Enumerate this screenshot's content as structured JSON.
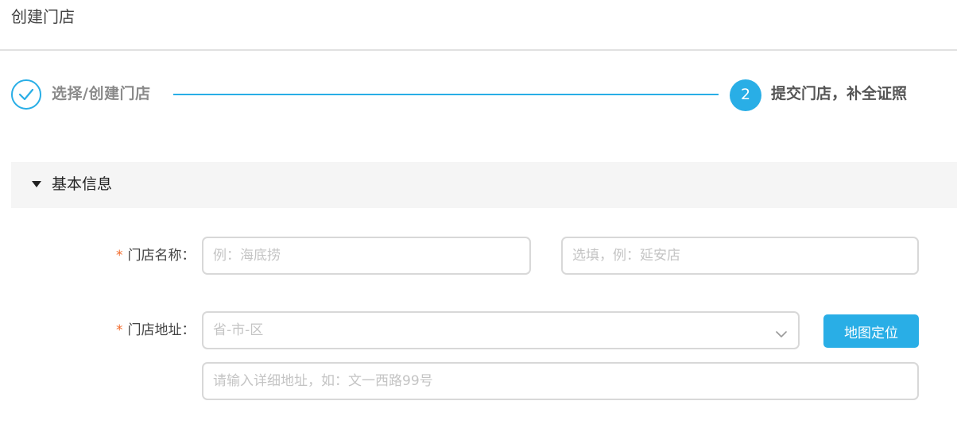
{
  "page": {
    "title": "创建门店"
  },
  "steps": {
    "step1": {
      "label": "选择/创建门店",
      "status": "completed"
    },
    "step2": {
      "number": "2",
      "label": "提交门店，补全证照",
      "status": "active"
    }
  },
  "section": {
    "title": "基本信息"
  },
  "form": {
    "store_name": {
      "required_mark": "*",
      "label": "门店名称：",
      "name_placeholder": "例：海底捞",
      "branch_placeholder": "选填，例：延安店"
    },
    "store_address": {
      "required_mark": "*",
      "label": "门店地址：",
      "region_placeholder": "省-市-区",
      "detail_placeholder": "请输入详细地址，如：文一西路99号",
      "map_button_label": "地图定位"
    }
  },
  "colors": {
    "accent": "#29aee6",
    "required": "#f26a2a",
    "section_bg": "#f5f5f5"
  },
  "icons": {
    "step1": "check-circle-icon",
    "section_toggle": "caret-down-icon",
    "select": "chevron-down-icon"
  }
}
